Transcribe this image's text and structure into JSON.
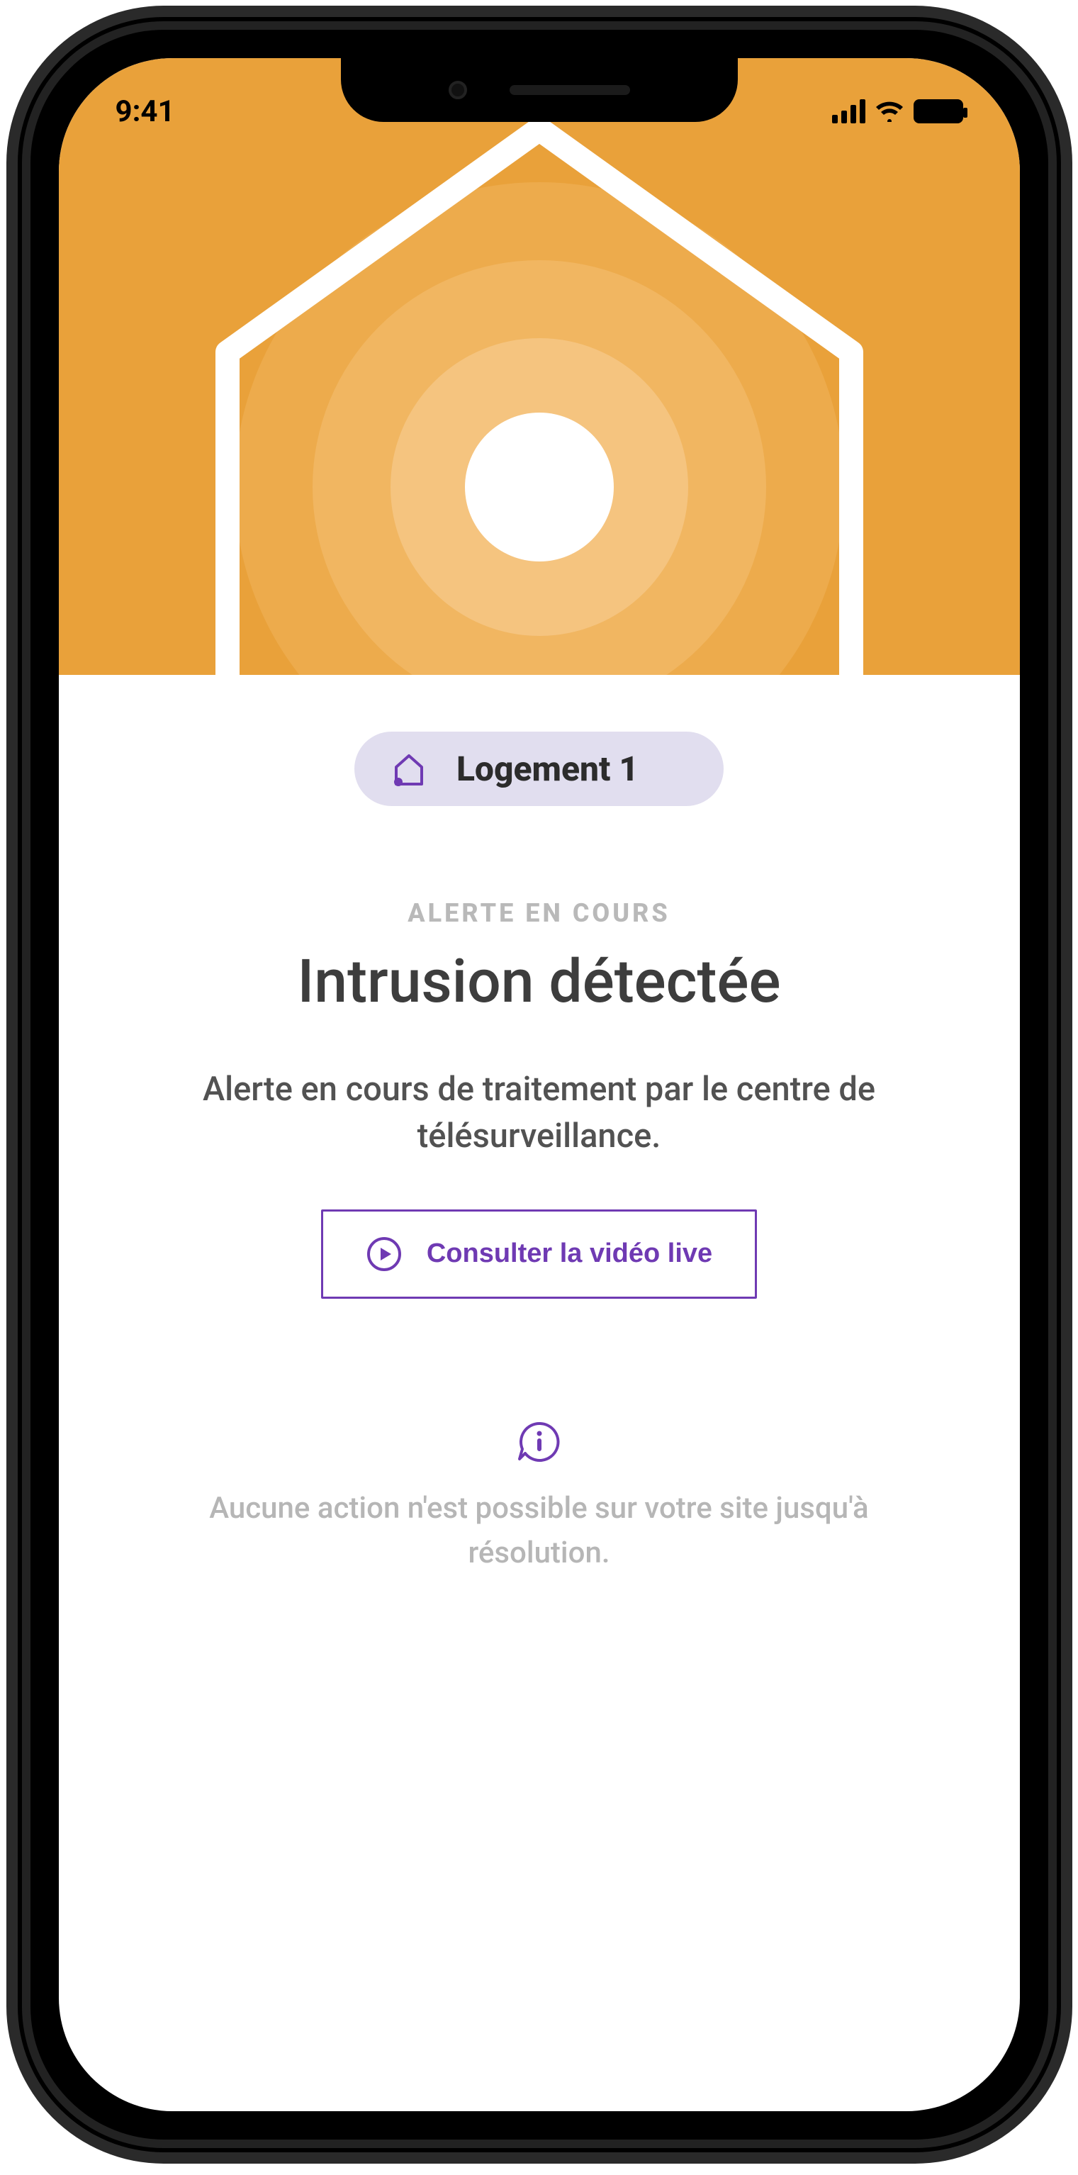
{
  "statusbar": {
    "time": "9:41"
  },
  "chip": {
    "label": "Logement 1"
  },
  "alert": {
    "eyebrow": "ALERTE EN COURS",
    "title": "Intrusion détectée",
    "description": "Alerte en cours de traitement par le centre de télésurveillance."
  },
  "cta": {
    "label": "Consulter la vidéo live"
  },
  "info": {
    "text": "Aucune action n'est possible sur votre site jusqu'à résolution."
  },
  "colors": {
    "hero": "#e9a13a",
    "accent": "#6f3ab3",
    "chipBg": "#e1deef"
  },
  "icons": {
    "house_chip": "house-icon",
    "play": "play-icon",
    "info": "info-bubble-icon",
    "signal": "cellular-signal-icon",
    "wifi": "wifi-icon",
    "battery": "battery-icon",
    "hero_house": "house-beacon-icon"
  }
}
